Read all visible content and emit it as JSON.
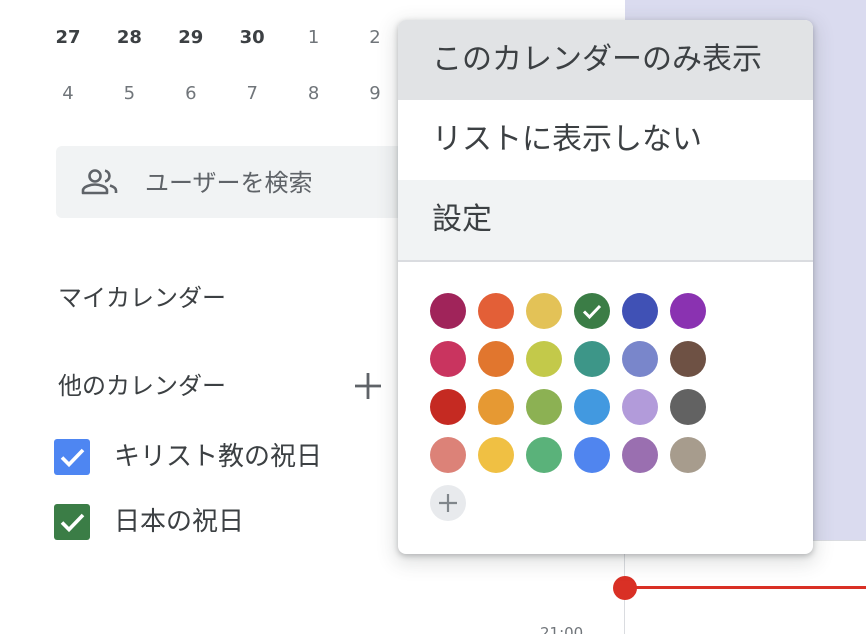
{
  "mini_calendar": {
    "week1": [
      {
        "label": "27",
        "current": true
      },
      {
        "label": "28",
        "current": true
      },
      {
        "label": "29",
        "current": true
      },
      {
        "label": "30",
        "current": true
      },
      {
        "label": "1",
        "current": false
      },
      {
        "label": "2",
        "current": false
      }
    ],
    "week2": [
      {
        "label": "4",
        "current": false
      },
      {
        "label": "5",
        "current": false
      },
      {
        "label": "6",
        "current": false
      },
      {
        "label": "7",
        "current": false
      },
      {
        "label": "8",
        "current": false
      },
      {
        "label": "9",
        "current": false
      }
    ]
  },
  "search": {
    "placeholder": "ユーザーを検索",
    "icon": "people-icon"
  },
  "my_calendars": {
    "title": "マイカレンダー"
  },
  "other_calendars": {
    "title": "他のカレンダー",
    "add_icon": "plus-icon",
    "items": [
      {
        "label": "キリスト教の祝日",
        "checked": true,
        "color": "#4e86f2"
      },
      {
        "label": "日本の祝日",
        "checked": true,
        "color": "#3b7d46"
      }
    ]
  },
  "context_menu": {
    "items": [
      "このカレンダーのみ表示",
      "リストに表示しない",
      "設定"
    ],
    "colors": [
      [
        "#a0245a",
        "#e35f37",
        "#e3c257",
        "#3b7d46",
        "#4051b5",
        "#8a32b1"
      ],
      [
        "#c9345f",
        "#e1762e",
        "#c3c94a",
        "#3d9688",
        "#7986cb",
        "#6e5144"
      ],
      [
        "#c52a22",
        "#e69933",
        "#8cb153",
        "#4299e0",
        "#b29bda",
        "#626262"
      ],
      [
        "#dc8278",
        "#f0c043",
        "#5ab27a",
        "#5085ef",
        "#9a6fb0",
        "#a79c8d"
      ]
    ],
    "selected_color": "#3b7d46",
    "add_color_icon": "plus-icon"
  },
  "timeline": {
    "time_label": "21:00",
    "now_color": "#d93025"
  }
}
